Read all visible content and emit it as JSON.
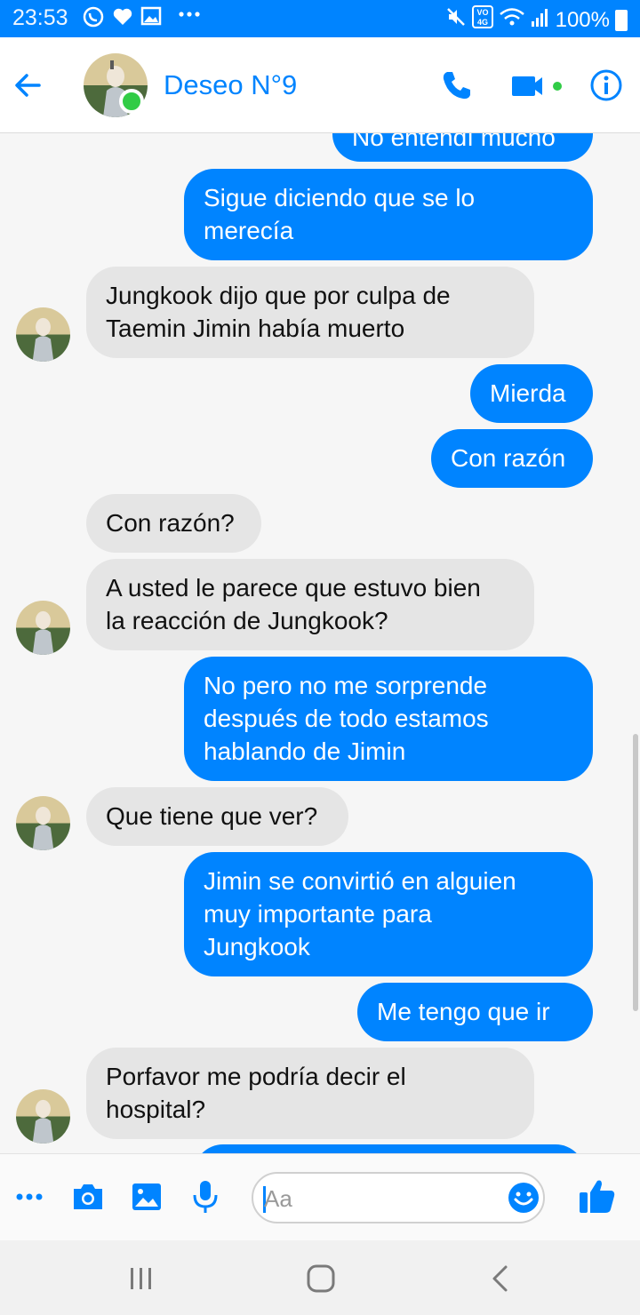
{
  "status_bar": {
    "time": "23:53",
    "battery": "100%",
    "icons": [
      "whatsapp-icon",
      "heart-icon",
      "gallery-icon",
      "more-icon",
      "mute-icon",
      "volte-icon",
      "wifi-icon",
      "signal-icon",
      "battery-icon"
    ]
  },
  "header": {
    "contact_name": "Deseo N°9",
    "accent_color": "#0084ff",
    "online_color": "#31cc46"
  },
  "messages": [
    {
      "dir": "out",
      "text": "No entendí mucho"
    },
    {
      "dir": "out",
      "lines": [
        "Sigue diciendo que se lo",
        "merecía"
      ]
    },
    {
      "dir": "in",
      "lines": [
        "Jungkook dijo que por culpa de",
        "Taemin Jimin había muerto"
      ]
    },
    {
      "dir": "out",
      "text": "Mierda"
    },
    {
      "dir": "out",
      "text": "Con razón"
    },
    {
      "dir": "in",
      "text": "Con razón?"
    },
    {
      "dir": "in",
      "lines": [
        "A usted le parece que estuvo bien",
        "la reacción de Jungkook?"
      ]
    },
    {
      "dir": "out",
      "lines": [
        "No pero no me sorprende",
        "después de todo estamos",
        "hablando de Jimin"
      ]
    },
    {
      "dir": "in",
      "text": "Que tiene que ver?"
    },
    {
      "dir": "out",
      "lines": [
        "Jimin se convirtió en alguien",
        "muy importante para",
        "Jungkook"
      ]
    },
    {
      "dir": "out",
      "text": "Me tengo que ir"
    },
    {
      "dir": "in",
      "lines": [
        "Porfavor me podría decir el",
        "hospital?"
      ]
    }
  ],
  "composer": {
    "placeholder": "Aa"
  }
}
